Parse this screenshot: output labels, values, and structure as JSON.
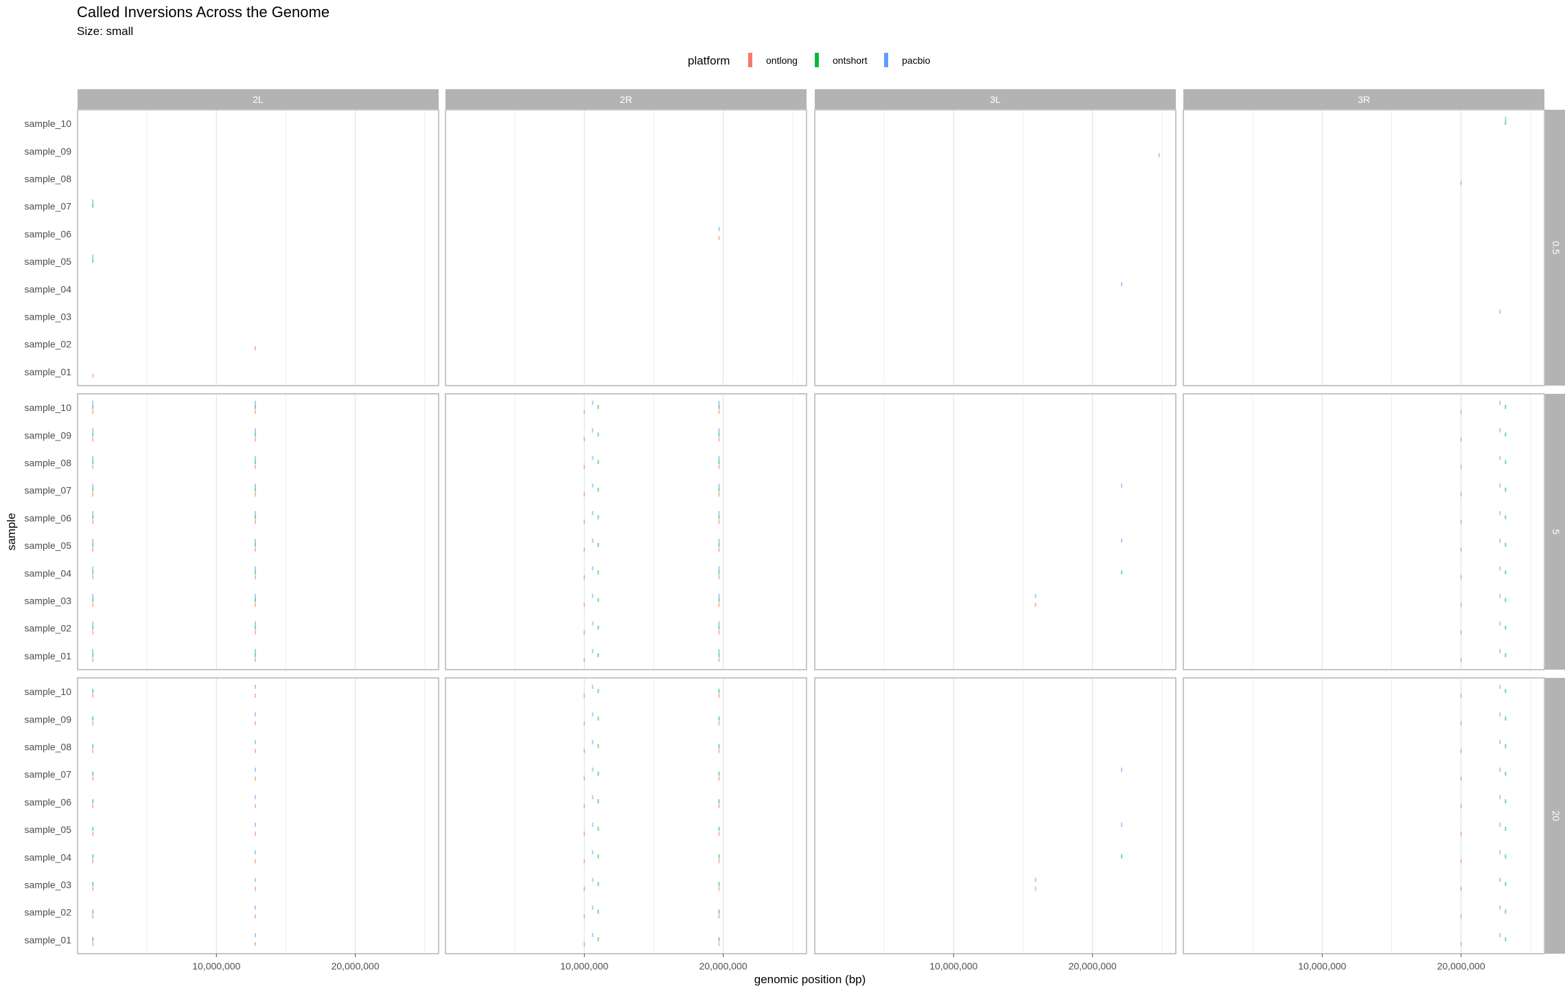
{
  "chart_data": {
    "type": "scatter",
    "title": "Called Inversions Across the Genome",
    "subtitle": "Size: small",
    "xlabel": "genomic position (bp)",
    "ylabel": "sample",
    "legend": {
      "title": "platform",
      "position": "top",
      "entries": [
        {
          "name": "ontlong",
          "color": "#F8766D"
        },
        {
          "name": "ontshort",
          "color": "#00BA38"
        },
        {
          "name": "pacbio",
          "color": "#619CFF"
        }
      ]
    },
    "facet_cols": [
      "2L",
      "2R",
      "3L",
      "3R"
    ],
    "facet_rows": [
      "0.5",
      "5",
      "20"
    ],
    "xlim": [
      0,
      26000000
    ],
    "x_ticks": [
      10000000,
      20000000
    ],
    "x_tick_labels": [
      "10,000,000",
      "20,000,000"
    ],
    "y_categories": [
      "sample_01",
      "sample_02",
      "sample_03",
      "sample_04",
      "sample_05",
      "sample_06",
      "sample_07",
      "sample_08",
      "sample_09",
      "sample_10"
    ],
    "grid": true,
    "points": [
      {
        "facet_col": "2L",
        "facet_row": "0.5",
        "sample": "sample_07",
        "x": 1100000,
        "platform": "pacbio"
      },
      {
        "facet_col": "2L",
        "facet_row": "0.5",
        "sample": "sample_07",
        "x": 1100000,
        "platform": "ontshort"
      },
      {
        "facet_col": "2L",
        "facet_row": "0.5",
        "sample": "sample_05",
        "x": 1100000,
        "platform": "pacbio"
      },
      {
        "facet_col": "2L",
        "facet_row": "0.5",
        "sample": "sample_05",
        "x": 1100000,
        "platform": "ontshort"
      },
      {
        "facet_col": "2L",
        "facet_row": "0.5",
        "sample": "sample_01",
        "x": 1100000,
        "platform": "ontlong"
      },
      {
        "facet_col": "2L",
        "facet_row": "0.5",
        "sample": "sample_02",
        "x": 12800000,
        "platform": "ontlong"
      },
      {
        "facet_col": "2R",
        "facet_row": "0.5",
        "sample": "sample_06",
        "x": 19700000,
        "platform": "pacbio"
      },
      {
        "facet_col": "2R",
        "facet_row": "0.5",
        "sample": "sample_06",
        "x": 19700000,
        "platform": "ontlong"
      },
      {
        "facet_col": "3L",
        "facet_row": "0.5",
        "sample": "sample_09",
        "x": 24800000,
        "platform": "ontlong"
      },
      {
        "facet_col": "3L",
        "facet_row": "0.5",
        "sample": "sample_04",
        "x": 22100000,
        "platform": "pacbio"
      },
      {
        "facet_col": "3R",
        "facet_row": "0.5",
        "sample": "sample_10",
        "x": 23200000,
        "platform": "pacbio"
      },
      {
        "facet_col": "3R",
        "facet_row": "0.5",
        "sample": "sample_10",
        "x": 23200000,
        "platform": "ontshort"
      },
      {
        "facet_col": "3R",
        "facet_row": "0.5",
        "sample": "sample_08",
        "x": 20000000,
        "platform": "ontlong"
      },
      {
        "facet_col": "3R",
        "facet_row": "0.5",
        "sample": "sample_03",
        "x": 22800000,
        "platform": "pacbio"
      },
      {
        "facet_col": "2L",
        "facet_row": "5",
        "sample": "all",
        "x": 1100000,
        "platform": "ontlong"
      },
      {
        "facet_col": "2L",
        "facet_row": "5",
        "sample": "all",
        "x": 1100000,
        "platform": "ontshort"
      },
      {
        "facet_col": "2L",
        "facet_row": "5",
        "sample": "all",
        "x": 1100000,
        "platform": "pacbio"
      },
      {
        "facet_col": "2L",
        "facet_row": "5",
        "sample": "all",
        "x": 12800000,
        "platform": "ontlong"
      },
      {
        "facet_col": "2L",
        "facet_row": "5",
        "sample": "all",
        "x": 12800000,
        "platform": "ontshort"
      },
      {
        "facet_col": "2L",
        "facet_row": "5",
        "sample": "all",
        "x": 12800000,
        "platform": "pacbio"
      },
      {
        "facet_col": "2R",
        "facet_row": "5",
        "sample": "all",
        "x": 10000000,
        "platform": "ontlong"
      },
      {
        "facet_col": "2R",
        "facet_row": "5",
        "sample": "all",
        "x": 10600000,
        "platform": "pacbio"
      },
      {
        "facet_col": "2R",
        "facet_row": "5",
        "sample": "all",
        "x": 11000000,
        "platform": "ontshort"
      },
      {
        "facet_col": "2R",
        "facet_row": "5",
        "sample": "all",
        "x": 19700000,
        "platform": "ontlong"
      },
      {
        "facet_col": "2R",
        "facet_row": "5",
        "sample": "all",
        "x": 19700000,
        "platform": "ontshort"
      },
      {
        "facet_col": "2R",
        "facet_row": "5",
        "sample": "all",
        "x": 19700000,
        "platform": "pacbio"
      },
      {
        "facet_col": "3L",
        "facet_row": "5",
        "sample": "sample_07",
        "x": 22100000,
        "platform": "pacbio"
      },
      {
        "facet_col": "3L",
        "facet_row": "5",
        "sample": "sample_05",
        "x": 22100000,
        "platform": "pacbio"
      },
      {
        "facet_col": "3L",
        "facet_row": "5",
        "sample": "sample_04",
        "x": 22100000,
        "platform": "ontshort"
      },
      {
        "facet_col": "3L",
        "facet_row": "5",
        "sample": "sample_03",
        "x": 15900000,
        "platform": "ontlong"
      },
      {
        "facet_col": "3L",
        "facet_row": "5",
        "sample": "sample_03",
        "x": 15900000,
        "platform": "pacbio"
      },
      {
        "facet_col": "3R",
        "facet_row": "5",
        "sample": "all",
        "x": 20000000,
        "platform": "ontlong"
      },
      {
        "facet_col": "3R",
        "facet_row": "5",
        "sample": "all",
        "x": 22800000,
        "platform": "pacbio"
      },
      {
        "facet_col": "3R",
        "facet_row": "5",
        "sample": "all",
        "x": 23200000,
        "platform": "ontshort"
      },
      {
        "facet_col": "2L",
        "facet_row": "20",
        "sample": "all",
        "x": 1100000,
        "platform": "ontlong"
      },
      {
        "facet_col": "2L",
        "facet_row": "20",
        "sample": "all",
        "x": 1100000,
        "platform": "ontshort"
      },
      {
        "facet_col": "2L",
        "facet_row": "20",
        "sample": "all",
        "x": 12800000,
        "platform": "ontlong"
      },
      {
        "facet_col": "2L",
        "facet_row": "20",
        "sample": "all",
        "x": 12800000,
        "platform": "pacbio"
      },
      {
        "facet_col": "2R",
        "facet_row": "20",
        "sample": "all",
        "x": 10000000,
        "platform": "ontlong"
      },
      {
        "facet_col": "2R",
        "facet_row": "20",
        "sample": "all",
        "x": 10600000,
        "platform": "pacbio"
      },
      {
        "facet_col": "2R",
        "facet_row": "20",
        "sample": "all",
        "x": 11000000,
        "platform": "ontshort"
      },
      {
        "facet_col": "2R",
        "facet_row": "20",
        "sample": "all",
        "x": 19700000,
        "platform": "ontlong"
      },
      {
        "facet_col": "2R",
        "facet_row": "20",
        "sample": "all",
        "x": 19700000,
        "platform": "ontshort"
      },
      {
        "facet_col": "3L",
        "facet_row": "20",
        "sample": "sample_07",
        "x": 22100000,
        "platform": "pacbio"
      },
      {
        "facet_col": "3L",
        "facet_row": "20",
        "sample": "sample_05",
        "x": 22100000,
        "platform": "pacbio"
      },
      {
        "facet_col": "3L",
        "facet_row": "20",
        "sample": "sample_04",
        "x": 22100000,
        "platform": "ontshort"
      },
      {
        "facet_col": "3L",
        "facet_row": "20",
        "sample": "sample_03",
        "x": 15900000,
        "platform": "ontlong"
      },
      {
        "facet_col": "3L",
        "facet_row": "20",
        "sample": "sample_03",
        "x": 15900000,
        "platform": "pacbio"
      },
      {
        "facet_col": "3R",
        "facet_row": "20",
        "sample": "all",
        "x": 20000000,
        "platform": "ontlong"
      },
      {
        "facet_col": "3R",
        "facet_row": "20",
        "sample": "all",
        "x": 22800000,
        "platform": "pacbio"
      },
      {
        "facet_col": "3R",
        "facet_row": "20",
        "sample": "all",
        "x": 23200000,
        "platform": "ontshort"
      }
    ]
  }
}
